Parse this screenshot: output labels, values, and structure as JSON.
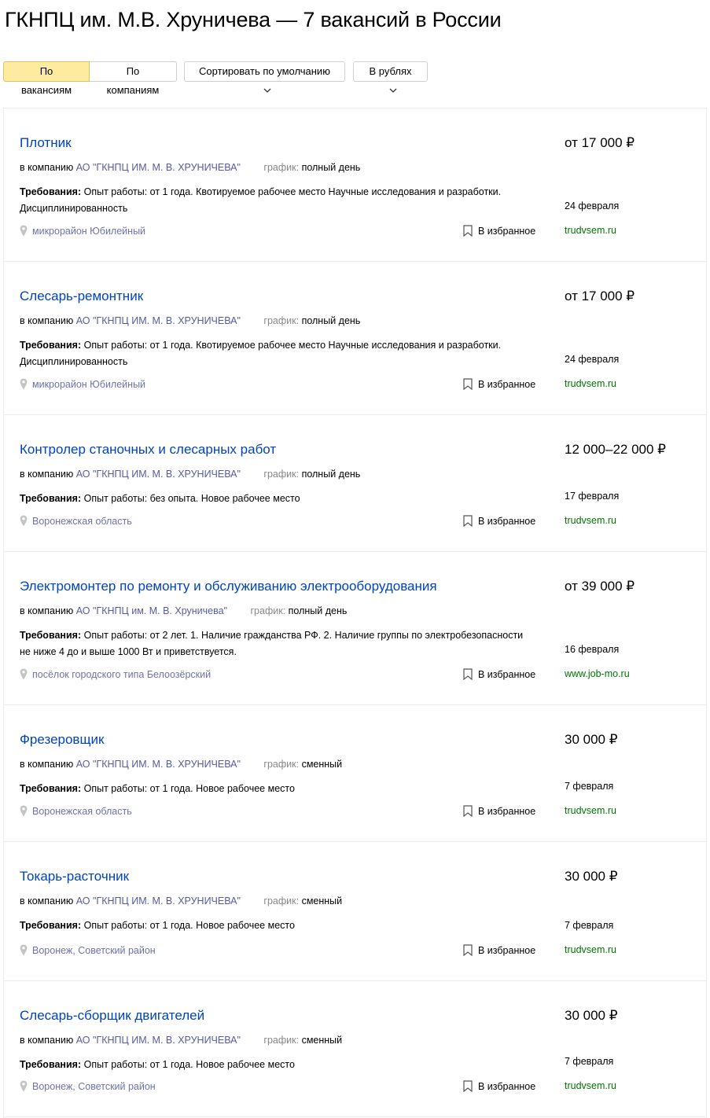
{
  "page": {
    "title": "ГКНПЦ им. М.В. Хруничева — 7 вакансий в России"
  },
  "toolbar": {
    "by_vacancies": "По вакансиям",
    "by_companies": "По компаниям",
    "sort": "Сортировать по умолчанию",
    "currency": "В рублях"
  },
  "common": {
    "company_prefix": "в компанию",
    "schedule_label": "график:",
    "req_label": "Требования:",
    "favorite": "В избранное"
  },
  "colors": {
    "link": "#0044bb",
    "company": "#555aa0",
    "source": "#007700",
    "active_tab": "#ffeba0"
  },
  "jobs": [
    {
      "title": "Плотник",
      "salary": "от 17 000 ₽",
      "company": "АО \"ГКНПЦ ИМ. М. В. ХРУНИЧЕВА\"",
      "schedule": "полный день",
      "req": "Опыт работы: от 1 года. Квотируемое рабочее место Научные исследования и разработки. Дисциплинированность",
      "date": "24 февраля",
      "location": "микрорайон Юбилейный",
      "source": "trudvsem.ru"
    },
    {
      "title": "Слесарь-ремонтник",
      "salary": "от 17 000 ₽",
      "company": "АО \"ГКНПЦ ИМ. М. В. ХРУНИЧЕВА\"",
      "schedule": "полный день",
      "req": "Опыт работы: от 1 года. Квотируемое рабочее место Научные исследования и разработки. Дисциплинированность",
      "date": "24 февраля",
      "location": "микрорайон Юбилейный",
      "source": "trudvsem.ru"
    },
    {
      "title": "Контролер станочных и слесарных работ",
      "salary": "12 000–22 000 ₽",
      "company": "АО \"ГКНПЦ ИМ. М. В. ХРУНИЧЕВА\"",
      "schedule": "полный день",
      "req": "Опыт работы: без опыта. Новое рабочее место",
      "date": "17 февраля",
      "location": "Воронежская область",
      "source": "trudvsem.ru"
    },
    {
      "title": "Электромонтер по ремонту и обслуживанию электрооборудования",
      "salary": "от 39 000 ₽",
      "company": "АО \"ГКНПЦ им. М. В. Хруничева\"",
      "schedule": "полный день",
      "req": "Опыт работы: от 2 лет. 1. Наличие гражданства РФ. 2. Наличие группы по электробезопасности не ниже 4 до и выше 1000 Вт и приветствуется.",
      "date": "16 февраля",
      "location": "посёлок городского типа Белоозёрский",
      "source": "www.job-mo.ru"
    },
    {
      "title": "Фрезеровщик",
      "salary": "30 000 ₽",
      "company": "АО \"ГКНПЦ ИМ. М. В. ХРУНИЧЕВА\"",
      "schedule": "сменный",
      "req": "Опыт работы: от 1 года. Новое рабочее место",
      "date": "7 февраля",
      "location": "Воронежская область",
      "source": "trudvsem.ru"
    },
    {
      "title": "Токарь-расточник",
      "salary": "30 000 ₽",
      "company": "АО \"ГКНПЦ ИМ. М. В. ХРУНИЧЕВА\"",
      "schedule": "сменный",
      "req": "Опыт работы: от 1 года. Новое рабочее место",
      "date": "7 февраля",
      "location": "Воронеж, Советский район",
      "source": "trudvsem.ru"
    },
    {
      "title": "Слесарь-сборщик двигателей",
      "salary": "30 000 ₽",
      "company": "АО \"ГКНПЦ ИМ. М. В. ХРУНИЧЕВА\"",
      "schedule": "сменный",
      "req": "Опыт работы: от 1 года. Новое рабочее место",
      "date": "7 февраля",
      "location": "Воронеж, Советский район",
      "source": "trudvsem.ru"
    }
  ]
}
